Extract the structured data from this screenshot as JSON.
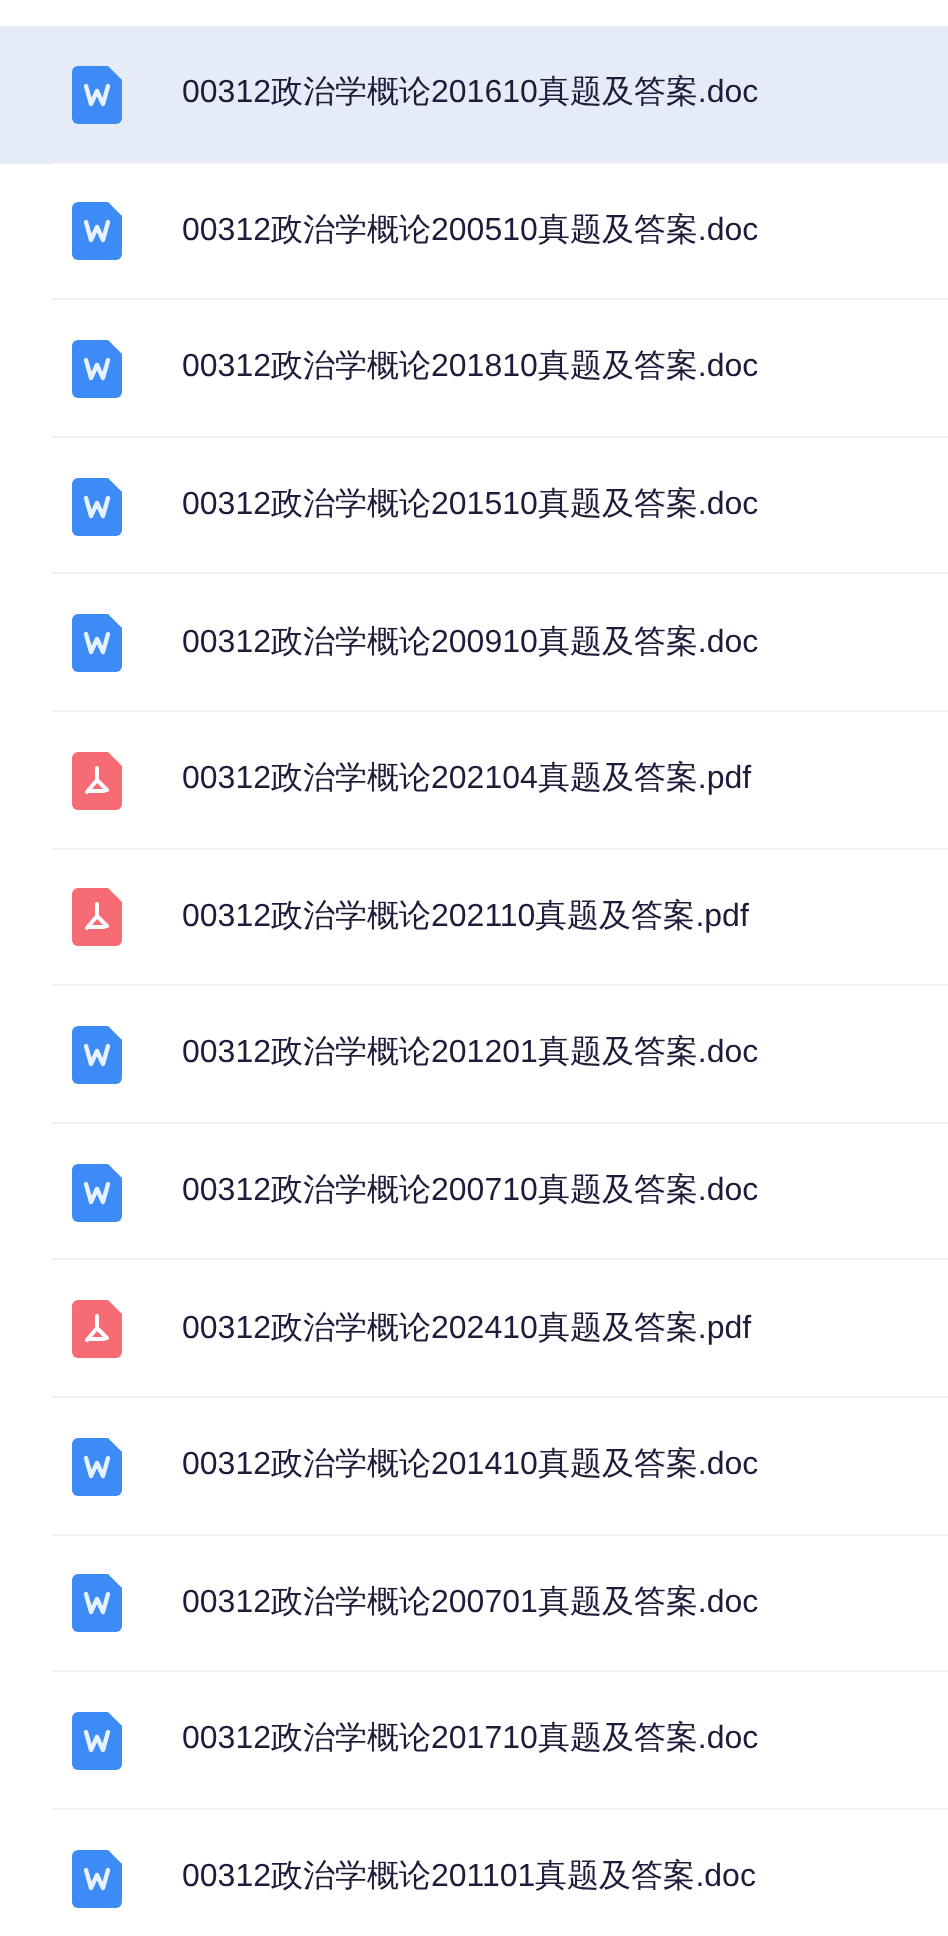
{
  "files": [
    {
      "name": "00312政治学概论201610真题及答案.doc",
      "kind": "doc",
      "selected": true
    },
    {
      "name": "00312政治学概论200510真题及答案.doc",
      "kind": "doc",
      "selected": false
    },
    {
      "name": "00312政治学概论201810真题及答案.doc",
      "kind": "doc",
      "selected": false
    },
    {
      "name": "00312政治学概论201510真题及答案.doc",
      "kind": "doc",
      "selected": false
    },
    {
      "name": "00312政治学概论200910真题及答案.doc",
      "kind": "doc",
      "selected": false
    },
    {
      "name": "00312政治学概论202104真题及答案.pdf",
      "kind": "pdf",
      "selected": false
    },
    {
      "name": "00312政治学概论202110真题及答案.pdf",
      "kind": "pdf",
      "selected": false
    },
    {
      "name": "00312政治学概论201201真题及答案.doc",
      "kind": "doc",
      "selected": false
    },
    {
      "name": "00312政治学概论200710真题及答案.doc",
      "kind": "doc",
      "selected": false
    },
    {
      "name": "00312政治学概论202410真题及答案.pdf",
      "kind": "pdf",
      "selected": false
    },
    {
      "name": "00312政治学概论201410真题及答案.doc",
      "kind": "doc",
      "selected": false
    },
    {
      "name": "00312政治学概论200701真题及答案.doc",
      "kind": "doc",
      "selected": false
    },
    {
      "name": "00312政治学概论201710真题及答案.doc",
      "kind": "doc",
      "selected": false
    },
    {
      "name": "00312政治学概论201101真题及答案.doc",
      "kind": "doc",
      "selected": false
    }
  ]
}
